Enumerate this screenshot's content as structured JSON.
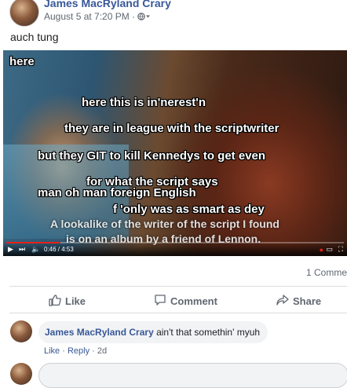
{
  "post": {
    "author": "James MacRyland Crary",
    "timestamp": "August 5 at 7:20 PM",
    "separator": "·",
    "text": "auch tung"
  },
  "video": {
    "overlay_lines": [
      "here",
      "here this is in'nerest'n",
      "they are in league with the scriptwriter",
      "but they GIT to kill Kennedys to get even",
      "for what the script says",
      "man oh man foreign English",
      "f 'only was as smart as dey"
    ],
    "subtitle_lines": [
      "A lookalike of the writer of the script I found",
      "is on an album by a friend of Lennon."
    ],
    "time": "0:46 / 4:53",
    "progress": 0.16
  },
  "stats": {
    "comments": "1 Comme"
  },
  "actions": {
    "like": "Like",
    "comment": "Comment",
    "share": "Share"
  },
  "comment": {
    "author": "James MacRyland Crary",
    "text": "ain't that somethin' myuh",
    "like": "Like",
    "reply": "Reply",
    "dot": "·",
    "age": "2d"
  },
  "colors": {
    "link": "#385898",
    "secondary": "#606770",
    "progress": "#e62117"
  }
}
